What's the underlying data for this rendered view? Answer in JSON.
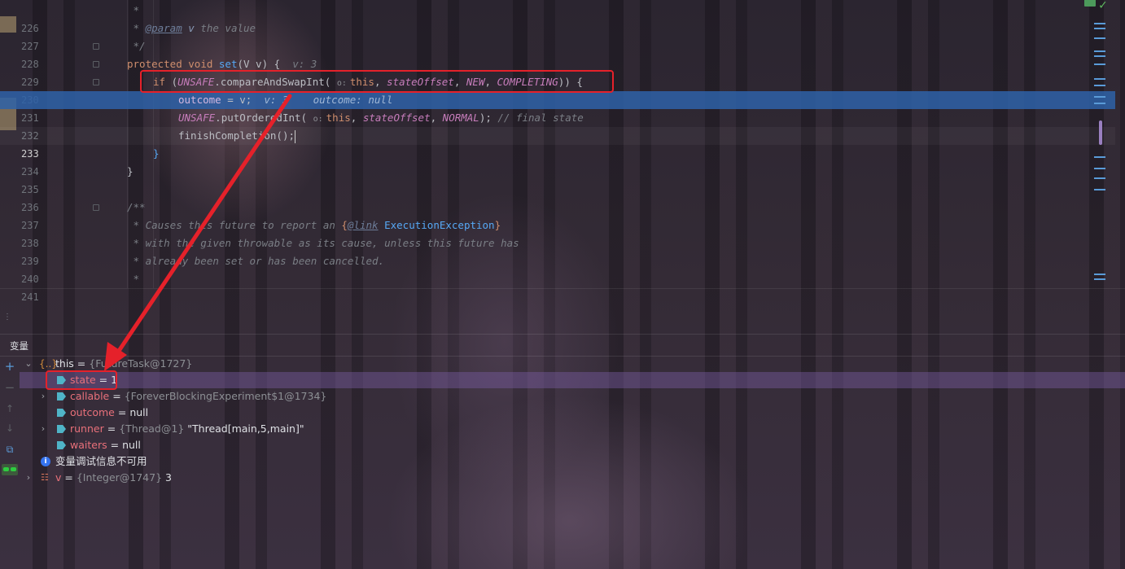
{
  "editor": {
    "lines": [
      {
        "n": "226",
        "kind": "doc_star"
      },
      {
        "n": "227",
        "kind": "doc_param",
        "tag": "@param",
        "param": "v",
        "text": "the value"
      },
      {
        "n": "228",
        "kind": "doc_end"
      },
      {
        "n": "229",
        "kind": "set_decl",
        "hint": "v: 3"
      },
      {
        "n": "230",
        "kind": "if_cas"
      },
      {
        "n": "231",
        "kind": "outcome",
        "hint1": "v: 3",
        "hint2": "outcome: null"
      },
      {
        "n": "232",
        "kind": "put_ordered",
        "comment": "// final state"
      },
      {
        "n": "233",
        "kind": "finish"
      },
      {
        "n": "234",
        "kind": "close_inner"
      },
      {
        "n": "235",
        "kind": "close_outer"
      },
      {
        "n": "236",
        "kind": "blank"
      },
      {
        "n": "237",
        "kind": "doc_start"
      },
      {
        "n": "238",
        "kind": "doc_text",
        "text": " * Causes this future to report an ",
        "link_tag": "@link",
        "link": "ExecutionException"
      },
      {
        "n": "239",
        "kind": "doc_text2",
        "text": " * with the given throwable as its cause, unless this future has"
      },
      {
        "n": "240",
        "kind": "doc_text2",
        "text": " * already been set or has been cancelled."
      },
      {
        "n": "241",
        "kind": "doc_star"
      }
    ],
    "tokens": {
      "protected": "protected",
      "void": "void",
      "set": "set",
      "sig": "(V v) {",
      "if": "if",
      "unsafe": "UNSAFE",
      "cas": "compareAndSwapInt",
      "this": "this",
      "stateOffset": "stateOffset",
      "NEW": "NEW",
      "COMPLETING": "COMPLETING",
      "outcome": "outcome",
      "putOrdered": "putOrderedInt",
      "NORMAL": "NORMAL",
      "finish": "finishCompletion",
      "o_hint": "o:"
    }
  },
  "panel": {
    "title": "变量",
    "variables": [
      {
        "id": "this",
        "expand": "open",
        "icon": "object-icon",
        "name": "this",
        "type": "{FutureTask@1727}",
        "value": ""
      },
      {
        "id": "state",
        "expand": "none",
        "icon": "field-icon",
        "name": "state",
        "type": "",
        "value": "1",
        "selected": true
      },
      {
        "id": "callable",
        "expand": "closed",
        "icon": "field-icon",
        "name": "callable",
        "type": "{ForeverBlockingExperiment$1@1734}",
        "value": ""
      },
      {
        "id": "outcome",
        "expand": "none",
        "icon": "field-icon",
        "name": "outcome",
        "type": "",
        "value": "null"
      },
      {
        "id": "runner",
        "expand": "closed",
        "icon": "field-icon",
        "name": "runner",
        "type": "{Thread@1}",
        "value": "\"Thread[main,5,main]\""
      },
      {
        "id": "waiters",
        "expand": "none",
        "icon": "field-icon",
        "name": "waiters",
        "type": "",
        "value": "null"
      },
      {
        "id": "info",
        "expand": "none",
        "icon": "info-icon",
        "name": "变量调试信息不可用",
        "type": "",
        "value": ""
      },
      {
        "id": "v",
        "expand": "closed",
        "icon": "local-var-icon",
        "name": "v",
        "type": "{Integer@1747}",
        "value": "3"
      }
    ],
    "eq": "="
  },
  "colors": {
    "exec_line": "#2e62a8",
    "selected_row": "#5a4378",
    "annotation_red": "#e5212a",
    "keyword": "#cf8e6d",
    "function": "#56a8f5",
    "field": "#c77dbb"
  }
}
